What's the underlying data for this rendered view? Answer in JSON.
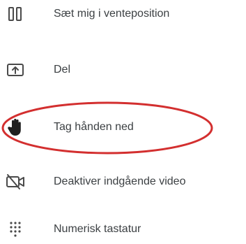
{
  "menu": {
    "items": [
      {
        "label": "Sæt mig i venteposition",
        "icon": "pause-icon"
      },
      {
        "label": "Del",
        "icon": "share-screen-icon"
      },
      {
        "label": "Tag hånden ned",
        "icon": "hand-icon"
      },
      {
        "label": "Deaktiver indgående video",
        "icon": "video-off-icon"
      },
      {
        "label": "Numerisk tastatur",
        "icon": "dialpad-icon"
      }
    ]
  },
  "annotation": {
    "color": "#d32f2f",
    "target": "Tag hånden ned"
  }
}
